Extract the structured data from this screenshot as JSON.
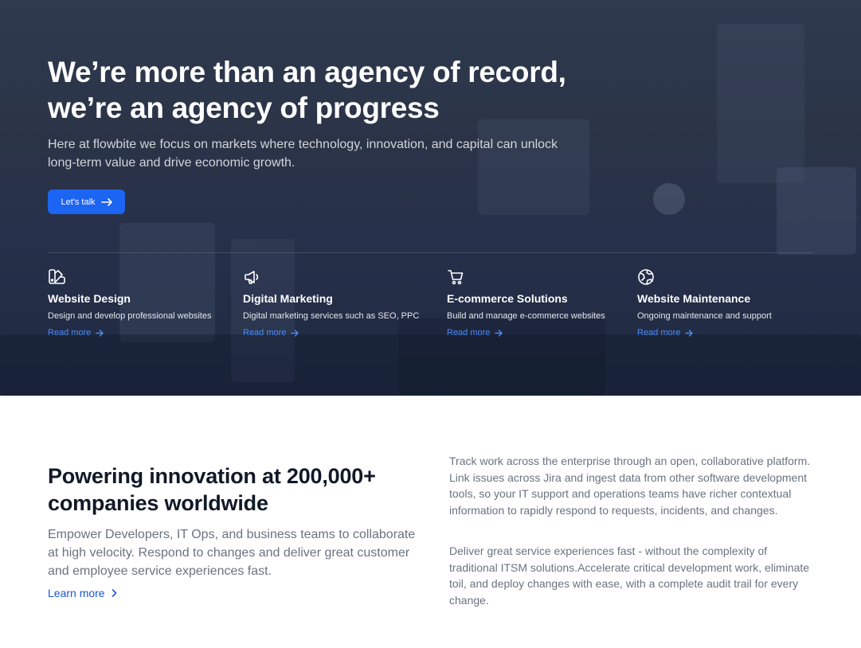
{
  "hero": {
    "title": "We’re more than an agency of record, we’re an agency of progress",
    "subtitle": "Here at flowbite we focus on markets where technology, innovation, and capital can unlock long-term value and drive economic growth.",
    "cta_label": "Let's talk",
    "cta_icon": "arrow-right-icon",
    "services": [
      {
        "icon": "palette-icon",
        "title": "Website Design",
        "description": "Design and develop professional websites",
        "link_label": "Read more"
      },
      {
        "icon": "megaphone-icon",
        "title": "Digital Marketing",
        "description": "Digital marketing services such as SEO, PPC",
        "link_label": "Read more"
      },
      {
        "icon": "cart-icon",
        "title": "E-commerce Solutions",
        "description": "Build and manage e-commerce websites",
        "link_label": "Read more"
      },
      {
        "icon": "globe-icon",
        "title": "Website Maintenance",
        "description": "Ongoing maintenance and support",
        "link_label": "Read more"
      }
    ]
  },
  "features": {
    "title": "Powering innovation at 200,000+ companies worldwide",
    "subtitle": "Empower Developers, IT Ops, and business teams to collaborate at high velocity. Respond to changes and deliver great customer and employee service experiences fast.",
    "learn_more_label": "Learn more",
    "paragraph_1": "Track work across the enterprise through an open, collaborative platform. Link issues across Jira and ingest data from other software development tools, so your IT support and operations teams have richer contextual information to rapidly respond to requests, incidents, and changes.",
    "paragraph_2": "Deliver great service experiences fast - without the complexity of traditional ITSM solutions.Accelerate critical development work, eliminate toil, and deploy changes with ease, with a complete audit trail for every change."
  },
  "colors": {
    "primary": "#1c64f2",
    "link": "#4b8bf5",
    "hero_overlay": "#2b3447",
    "text_muted": "#6b7280"
  }
}
